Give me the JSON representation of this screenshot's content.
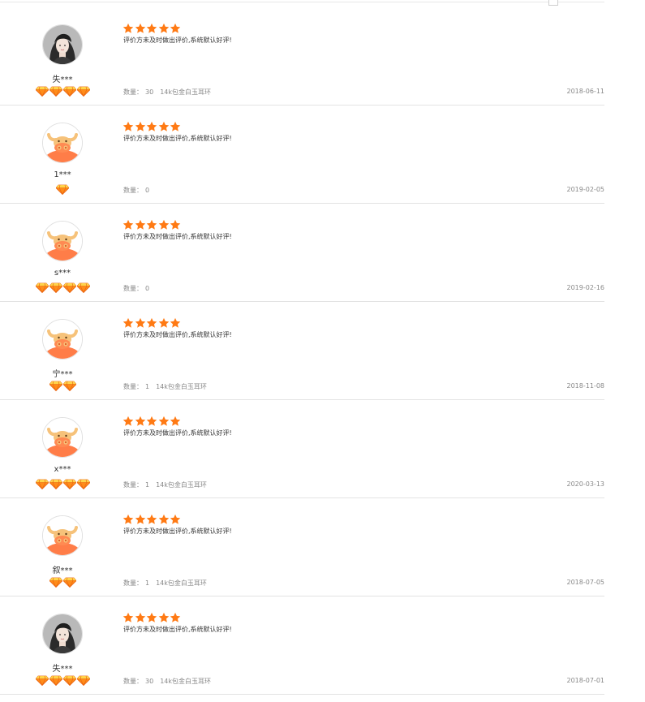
{
  "colors": {
    "star": "#ff7a14",
    "gem_top": "#ffd34a",
    "gem_bottom": "#ff8c1a",
    "gem_outline": "#e8600d"
  },
  "labels": {
    "quantity": "数量："
  },
  "reviews": [
    {
      "avatar": "woman-photo",
      "username": "失***",
      "gems": 4,
      "stars": 5,
      "content": "评价方未及时做出评价,系统默认好评!",
      "quantity": "30",
      "product": "14k包金白玉耳环",
      "date": "2018-06-11"
    },
    {
      "avatar": "bull-avatar",
      "username": "1***",
      "gems": 1,
      "stars": 5,
      "content": "评价方未及时做出评价,系统默认好评!",
      "quantity": "0",
      "product": "",
      "date": "2019-02-05"
    },
    {
      "avatar": "bull-avatar",
      "username": "s***",
      "gems": 4,
      "stars": 5,
      "content": "评价方未及时做出评价,系统默认好评!",
      "quantity": "0",
      "product": "",
      "date": "2019-02-16"
    },
    {
      "avatar": "bull-avatar",
      "username": "宁***",
      "gems": 2,
      "stars": 5,
      "content": "评价方未及时做出评价,系统默认好评!",
      "quantity": "1",
      "product": "14k包金白玉耳环",
      "date": "2018-11-08"
    },
    {
      "avatar": "bull-avatar",
      "username": "x***",
      "gems": 4,
      "stars": 5,
      "content": "评价方未及时做出评价,系统默认好评!",
      "quantity": "1",
      "product": "14k包金白玉耳环",
      "date": "2020-03-13"
    },
    {
      "avatar": "bull-avatar",
      "username": "叙***",
      "gems": 2,
      "stars": 5,
      "content": "评价方未及时做出评价,系统默认好评!",
      "quantity": "1",
      "product": "14k包金白玉耳环",
      "date": "2018-07-05"
    },
    {
      "avatar": "woman-photo",
      "username": "失***",
      "gems": 4,
      "stars": 5,
      "content": "评价方未及时做出评价,系统默认好评!",
      "quantity": "30",
      "product": "14k包金白玉耳环",
      "date": "2018-07-01"
    }
  ]
}
